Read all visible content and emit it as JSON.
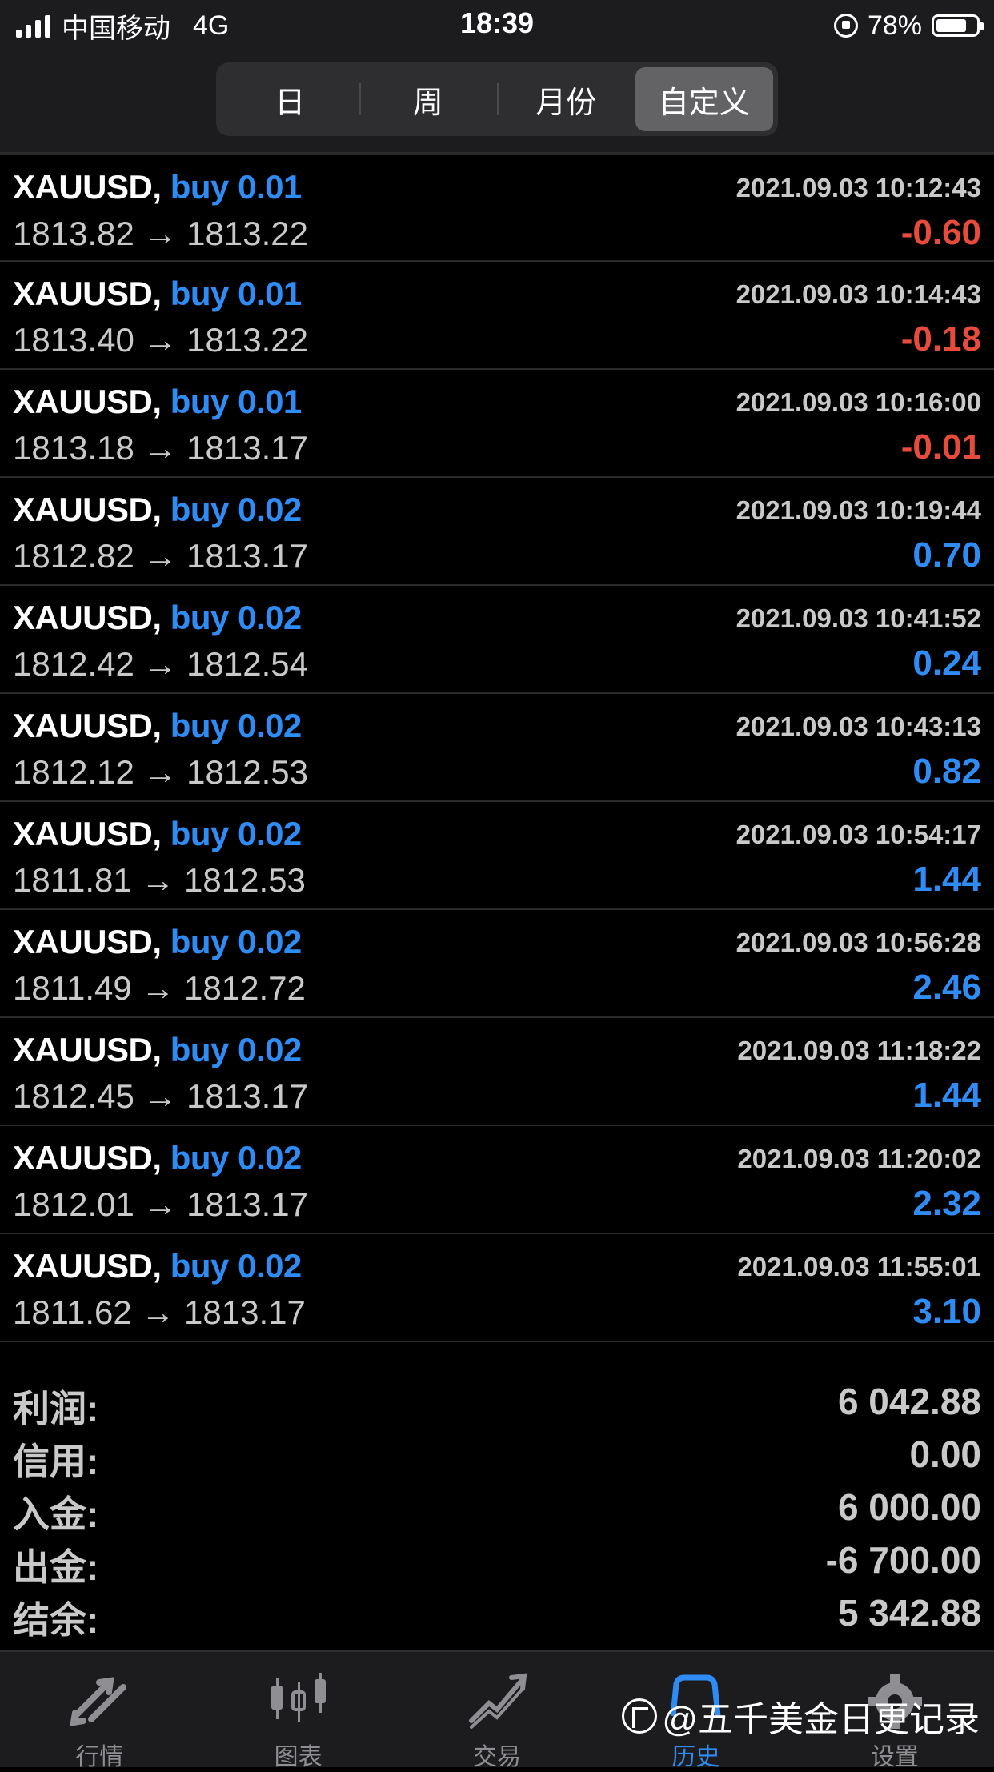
{
  "status_bar": {
    "carrier": "中国移动",
    "network": "4G",
    "time": "18:39",
    "battery": "78%"
  },
  "period_tabs": [
    {
      "label": "日",
      "active": false
    },
    {
      "label": "周",
      "active": false
    },
    {
      "label": "月份",
      "active": false
    },
    {
      "label": "自定义",
      "active": true
    }
  ],
  "trades": [
    {
      "symbol": "XAUUSD,",
      "side": "buy 0.01",
      "time": "2021.09.03 10:12:43",
      "open": "1813.82",
      "close": "1813.22",
      "profit": "-0.60",
      "negative": true
    },
    {
      "symbol": "XAUUSD,",
      "side": "buy 0.01",
      "time": "2021.09.03 10:14:43",
      "open": "1813.40",
      "close": "1813.22",
      "profit": "-0.18",
      "negative": true
    },
    {
      "symbol": "XAUUSD,",
      "side": "buy 0.01",
      "time": "2021.09.03 10:16:00",
      "open": "1813.18",
      "close": "1813.17",
      "profit": "-0.01",
      "negative": true
    },
    {
      "symbol": "XAUUSD,",
      "side": "buy 0.02",
      "time": "2021.09.03 10:19:44",
      "open": "1812.82",
      "close": "1813.17",
      "profit": "0.70",
      "negative": false
    },
    {
      "symbol": "XAUUSD,",
      "side": "buy 0.02",
      "time": "2021.09.03 10:41:52",
      "open": "1812.42",
      "close": "1812.54",
      "profit": "0.24",
      "negative": false
    },
    {
      "symbol": "XAUUSD,",
      "side": "buy 0.02",
      "time": "2021.09.03 10:43:13",
      "open": "1812.12",
      "close": "1812.53",
      "profit": "0.82",
      "negative": false
    },
    {
      "symbol": "XAUUSD,",
      "side": "buy 0.02",
      "time": "2021.09.03 10:54:17",
      "open": "1811.81",
      "close": "1812.53",
      "profit": "1.44",
      "negative": false
    },
    {
      "symbol": "XAUUSD,",
      "side": "buy 0.02",
      "time": "2021.09.03 10:56:28",
      "open": "1811.49",
      "close": "1812.72",
      "profit": "2.46",
      "negative": false
    },
    {
      "symbol": "XAUUSD,",
      "side": "buy 0.02",
      "time": "2021.09.03 11:18:22",
      "open": "1812.45",
      "close": "1813.17",
      "profit": "1.44",
      "negative": false
    },
    {
      "symbol": "XAUUSD,",
      "side": "buy 0.02",
      "time": "2021.09.03 11:20:02",
      "open": "1812.01",
      "close": "1813.17",
      "profit": "2.32",
      "negative": false
    },
    {
      "symbol": "XAUUSD,",
      "side": "buy 0.02",
      "time": "2021.09.03 11:55:01",
      "open": "1811.62",
      "close": "1813.17",
      "profit": "3.10",
      "negative": false
    }
  ],
  "arrow": "→",
  "summary": [
    {
      "label": "利润:",
      "value": "6 042.88"
    },
    {
      "label": "信用:",
      "value": "0.00"
    },
    {
      "label": "入金:",
      "value": "6 000.00"
    },
    {
      "label": "出金:",
      "value": "-6 700.00"
    },
    {
      "label": "结余:",
      "value": "5 342.88"
    }
  ],
  "tab_bar": [
    {
      "label": "行情",
      "icon": "quotes-arrows-icon",
      "active": false
    },
    {
      "label": "图表",
      "icon": "candlestick-chart-icon",
      "active": false
    },
    {
      "label": "交易",
      "icon": "trade-trend-icon",
      "active": false
    },
    {
      "label": "历史",
      "icon": "history-icon",
      "active": true
    },
    {
      "label": "设置",
      "icon": "gear-icon",
      "active": false
    }
  ],
  "watermark": "@五千美金日更记录",
  "colors": {
    "background": "#000000",
    "loss": "#e64b3c",
    "profit": "#2f8cf5",
    "muted": "#c9c9c9"
  }
}
